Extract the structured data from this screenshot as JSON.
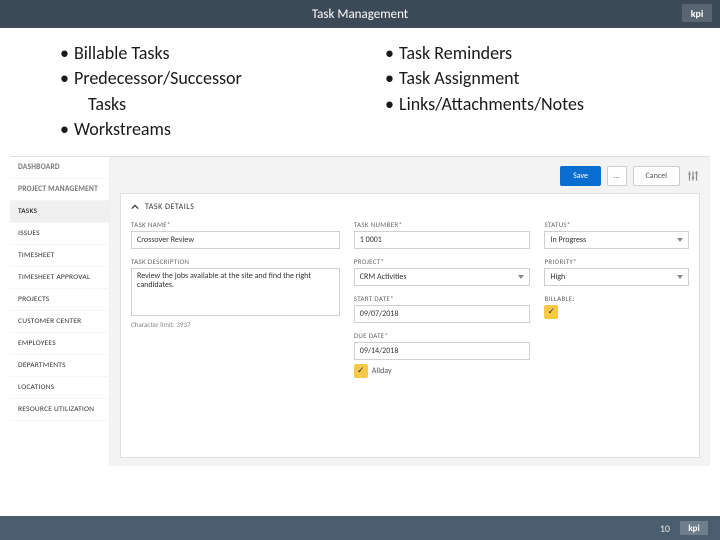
{
  "header": {
    "title": "Task Management",
    "logo_text": "kpi"
  },
  "bullets": {
    "left": [
      "Billable Tasks",
      "Predecessor/Successor",
      "Tasks",
      "Workstreams"
    ],
    "right": [
      "Task Reminders",
      "Task Assignment",
      "Links/Attachments/Notes"
    ]
  },
  "sidebar": {
    "items": [
      {
        "label": "DASHBOARD",
        "heading": true
      },
      {
        "label": "PROJECT MANAGEMENT",
        "heading": true
      },
      {
        "label": "Tasks",
        "active": true
      },
      {
        "label": "Issues"
      },
      {
        "label": "Timesheet"
      },
      {
        "label": "Timesheet Approval"
      },
      {
        "label": "Projects"
      },
      {
        "label": "Customer Center"
      },
      {
        "label": "Employees"
      },
      {
        "label": "Departments"
      },
      {
        "label": "Locations"
      },
      {
        "label": "Resource Utilization"
      }
    ]
  },
  "toolbar": {
    "save": "Save",
    "more": "…",
    "cancel": "Cancel"
  },
  "panel": {
    "title": "TASK DETAILS"
  },
  "form": {
    "task_name_label": "TASK NAME*",
    "task_name_value": "Crossover Review",
    "task_number_label": "TASK NUMBER*",
    "task_number_value": "1                              0001",
    "status_label": "STATUS*",
    "status_value": "In Progress",
    "description_label": "TASK DESCRIPTION",
    "description_value": "Review the jobs available at the site and find the right candidates.",
    "char_limit": "Character limit:   3937",
    "project_label": "PROJECT*",
    "project_value": "CRM Activities",
    "priority_label": "PRIORITY*",
    "priority_value": "High",
    "start_date_label": "START DATE*",
    "start_date_value": "09/07/2018",
    "due_date_label": "DUE DATE*",
    "due_date_value": "09/14/2018",
    "billable_label": "BILLABLE:",
    "allday_label": "Allday"
  },
  "footer": {
    "page": "10",
    "logo": "kpi"
  }
}
